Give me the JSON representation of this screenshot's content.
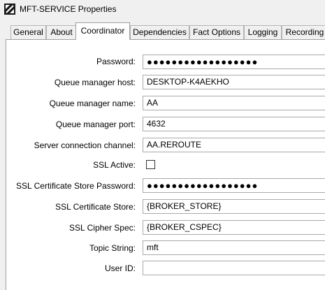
{
  "window": {
    "title": "MFT-SERVICE Properties"
  },
  "tabs": [
    {
      "label": "General",
      "active": false
    },
    {
      "label": "About",
      "active": false
    },
    {
      "label": "Coordinator",
      "active": true
    },
    {
      "label": "Dependencies",
      "active": false
    },
    {
      "label": "Fact Options",
      "active": false
    },
    {
      "label": "Logging",
      "active": false
    },
    {
      "label": "Recording",
      "active": false
    }
  ],
  "form": {
    "password": {
      "label": "Password:",
      "value": "●●●●●●●●●●●●●●●●●●"
    },
    "queue_manager_host": {
      "label": "Queue manager host:",
      "value": "DESKTOP-K4AEKHO"
    },
    "queue_manager_name": {
      "label": "Queue manager name:",
      "value": "AA"
    },
    "queue_manager_port": {
      "label": "Queue manager port:",
      "value": "4632"
    },
    "server_connection_channel": {
      "label": "Server connection channel:",
      "value": "AA.REROUTE"
    },
    "ssl_active": {
      "label": "SSL Active:",
      "checked": false
    },
    "ssl_cert_store_password": {
      "label": "SSL Certificate Store Password:",
      "value": "●●●●●●●●●●●●●●●●●●"
    },
    "ssl_cert_store": {
      "label": "SSL Certificate Store:",
      "value": "{BROKER_STORE}"
    },
    "ssl_cipher_spec": {
      "label": "SSL Cipher Spec:",
      "value": "{BROKER_CSPEC}"
    },
    "topic_string": {
      "label": "Topic String:",
      "value": "mft"
    },
    "user_id": {
      "label": "User ID:",
      "value": ""
    }
  }
}
